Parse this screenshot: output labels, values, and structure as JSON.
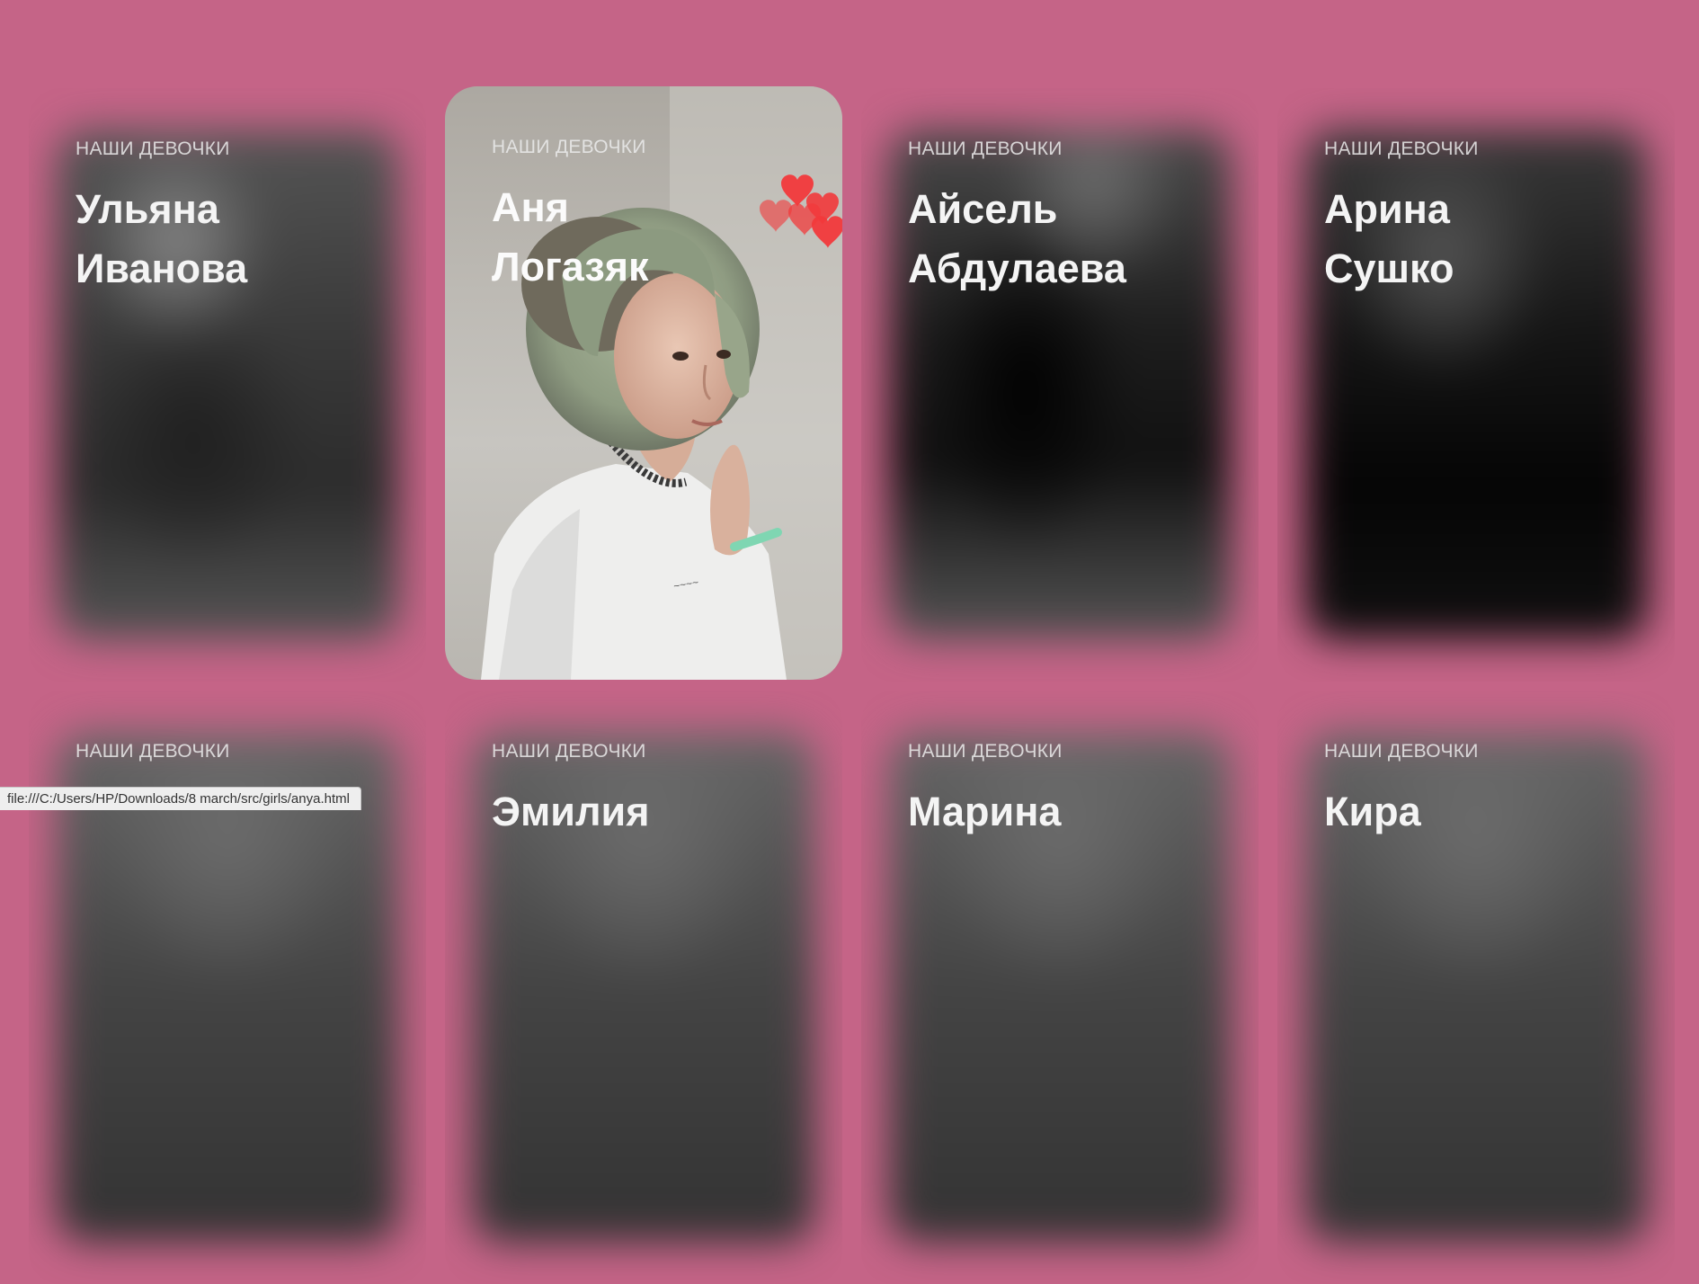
{
  "section_label": "НАШИ ДЕВОЧКИ",
  "cards": [
    {
      "first_name": "Ульяна",
      "last_name": "Иванова"
    },
    {
      "first_name": "Аня",
      "last_name": "Логазяк"
    },
    {
      "first_name": "Айсель",
      "last_name": "Абдулаева"
    },
    {
      "first_name": "Арина",
      "last_name": "Сушко"
    },
    {
      "first_name": "",
      "last_name": ""
    },
    {
      "first_name": "Эмилия",
      "last_name": ""
    },
    {
      "first_name": "Марина",
      "last_name": ""
    },
    {
      "first_name": "Кира",
      "last_name": ""
    }
  ],
  "status_bar": {
    "url": "file:///C:/Users/HP/Downloads/8 march/src/girls/anya.html"
  },
  "colors": {
    "page_background": "#c56487",
    "heart": "#f2393b"
  },
  "icons": [
    "heart-icon"
  ]
}
